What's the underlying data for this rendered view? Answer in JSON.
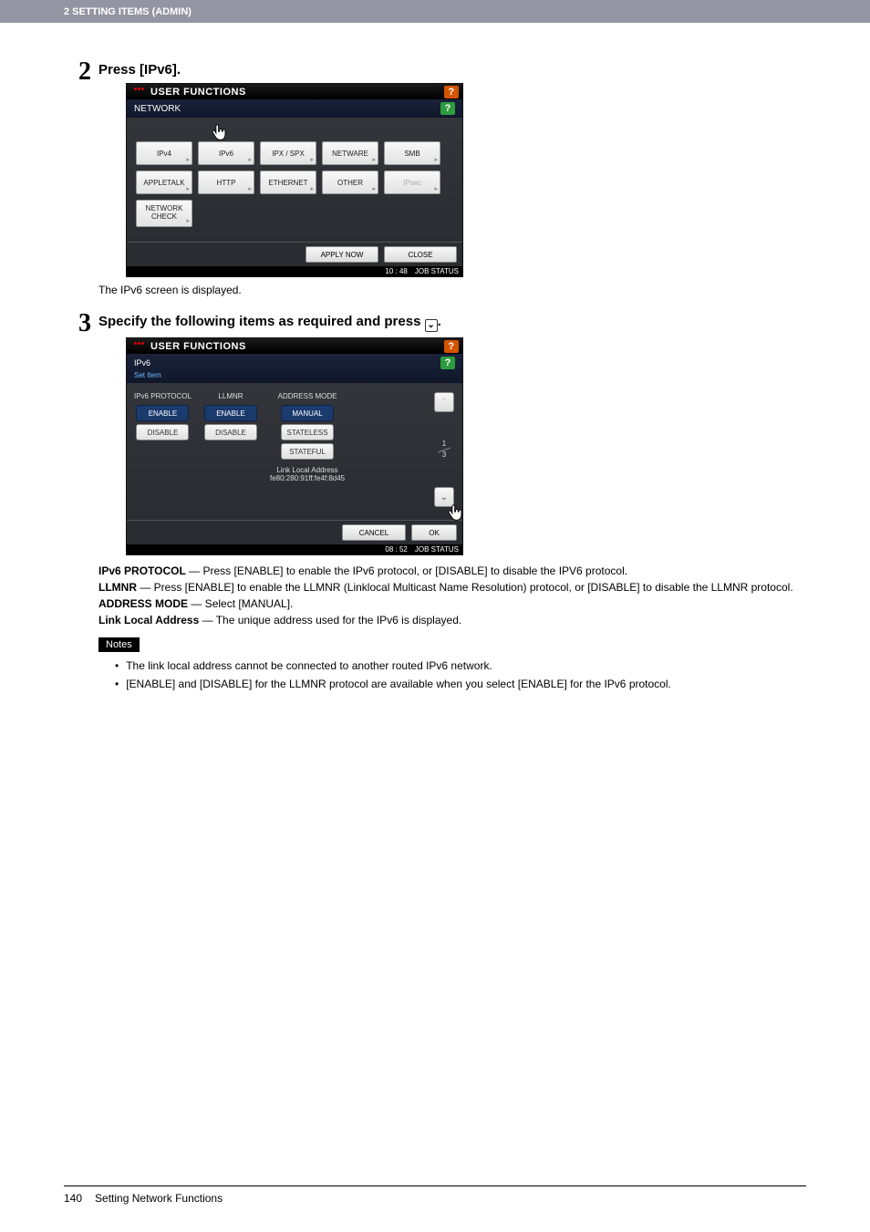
{
  "header": {
    "chapter": "2 SETTING ITEMS (ADMIN)"
  },
  "step2": {
    "num": "2",
    "title": "Press [IPv6].",
    "caption": "The IPv6 screen is displayed.",
    "console": {
      "title": "USER FUNCTIONS",
      "subtitle": "NETWORK",
      "help_top": "?",
      "help_sub": "?",
      "buttons_row1": [
        "IPv4",
        "IPv6",
        "IPX / SPX",
        "NETWARE",
        "SMB"
      ],
      "buttons_row2": [
        "APPLETALK",
        "HTTP",
        "ETHERNET",
        "OTHER",
        "IPsec"
      ],
      "buttons_row3": [
        "NETWORK CHECK"
      ],
      "apply": "APPLY NOW",
      "close": "CLOSE",
      "time": "10 : 48",
      "jobstatus": "JOB STATUS"
    }
  },
  "step3": {
    "num": "3",
    "title_before": "Specify the following items as required and press ",
    "title_after": ".",
    "console": {
      "title": "USER FUNCTIONS",
      "subtitle": "IPv6",
      "setitem": "Set Item",
      "help_top": "?",
      "help_sub": "?",
      "col1_label": "IPv6 PROTOCOL",
      "col1_opts": [
        "ENABLE",
        "DISABLE"
      ],
      "col2_label": "LLMNR",
      "col2_opts": [
        "ENABLE",
        "DISABLE"
      ],
      "col3_label": "ADDRESS MODE",
      "col3_opts": [
        "MANUAL",
        "STATELESS",
        "STATEFUL"
      ],
      "link_local_label": "Link Local Address",
      "link_local_value": "fe80:280:91ff:fe4f:8d45",
      "page_top": "1",
      "page_bottom": "3",
      "cancel": "CANCEL",
      "ok": "OK",
      "time": "08 : 52",
      "jobstatus": "JOB STATUS"
    },
    "desc": {
      "l1a": "IPv6 PROTOCOL",
      "l1b": " — Press [ENABLE] to enable the IPv6 protocol, or [DISABLE] to disable the IPV6 protocol.",
      "l2a": "LLMNR",
      "l2b": " — Press [ENABLE] to enable the LLMNR (Linklocal Multicast Name Resolution) protocol, or [DISABLE] to disable the LLMNR protocol.",
      "l3a": "ADDRESS MODE",
      "l3b": " — Select [MANUAL].",
      "l4a": "Link Local Address",
      "l4b": " — The unique address used for the IPv6 is displayed."
    },
    "notes_label": "Notes",
    "notes": {
      "n1": "The link local address cannot be connected to another routed IPv6 network.",
      "n2": "[ENABLE] and [DISABLE] for the LLMNR protocol are available when you select [ENABLE] for the IPv6 protocol."
    }
  },
  "footer": {
    "pagenum": "140",
    "section": "Setting Network Functions"
  }
}
